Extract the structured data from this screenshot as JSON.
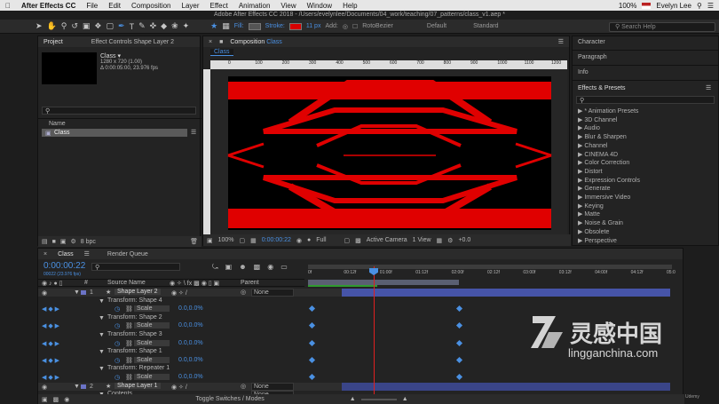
{
  "menubar": {
    "apple": "",
    "app_name": "After Effects CC",
    "items": [
      "File",
      "Edit",
      "Composition",
      "Layer",
      "Effect",
      "Animation",
      "View",
      "Window",
      "Help"
    ],
    "battery": "100%",
    "user": "Evelyn Lee"
  },
  "window_title": "Adobe After Effects CC 2018 - /Users/evelynlee/Documents/04_work/teaching/07_patterns/class_v1.aep *",
  "toolbar": {
    "fill_label": "Fill:",
    "stroke_label": "Stroke:",
    "stroke_px": "11 px",
    "add_label": "Add:",
    "rotobezier": "RotoBezier",
    "workspace_default": "Default",
    "workspace_standard": "Standard",
    "search_placeholder": "Search Help",
    "stroke_color": "#d60000"
  },
  "project_panel": {
    "tab_project": "Project",
    "tab_effect_controls": "Effect Controls Shape Layer 2",
    "comp_name": "Class ▾",
    "comp_size": "1280 x 720 (1.00)",
    "comp_duration": "Δ 0:00:05:00, 23.976 fps",
    "col_name": "Name",
    "item": "Class",
    "bpc": "8 bpc"
  },
  "comp_panel": {
    "tab_label": "Composition",
    "tab_comp": "Class",
    "sub_tab": "Class",
    "ruler_ticks": [
      "0",
      "100",
      "200",
      "300",
      "400",
      "500",
      "600",
      "700",
      "800",
      "900",
      "1000",
      "1100",
      "1200"
    ],
    "zoom": "100%",
    "timecode": "0:00:00:22",
    "resolution": "Full",
    "camera": "Active Camera",
    "view": "1 View",
    "offset": "+0.0"
  },
  "right_panels": {
    "character": "Character",
    "paragraph": "Paragraph",
    "info": "Info",
    "effects_title": "Effects & Presets",
    "effects": [
      "* Animation Presets",
      "3D Channel",
      "Audio",
      "Blur & Sharpen",
      "Channel",
      "CINEMA 4D",
      "Color Correction",
      "Distort",
      "Expression Controls",
      "Generate",
      "Immersive Video",
      "Keying",
      "Matte",
      "Noise & Grain",
      "Obsolete",
      "Perspective"
    ]
  },
  "timeline": {
    "tab_comp": "Class",
    "tab_render": "Render Queue",
    "timecode": "0:00:00:22",
    "frame_info": "00022 (23.976 fps)",
    "col_source": "Source Name",
    "col_parent": "Parent",
    "ruler": [
      "0f",
      "00:12f",
      "01:00f",
      "01:12f",
      "02:00f",
      "02:12f",
      "03:00f",
      "03:12f",
      "04:00f",
      "04:12f",
      "05:0"
    ],
    "rows": [
      {
        "num": "1",
        "name": "Shape Layer 2",
        "kind": "layer",
        "parent": "None"
      },
      {
        "name": "Transform: Shape 4",
        "kind": "group"
      },
      {
        "name": "Scale",
        "value": "0.0,0.0%",
        "kind": "prop"
      },
      {
        "name": "Transform: Shape 2",
        "kind": "group"
      },
      {
        "name": "Scale",
        "value": "0.0,0.0%",
        "kind": "prop"
      },
      {
        "name": "Transform: Shape 3",
        "kind": "group"
      },
      {
        "name": "Scale",
        "value": "0.0,0.0%",
        "kind": "prop"
      },
      {
        "name": "Transform: Shape 1",
        "kind": "group"
      },
      {
        "name": "Scale",
        "value": "0.0,0.0%",
        "kind": "prop"
      },
      {
        "name": "Transform: Repeater 1",
        "kind": "group"
      },
      {
        "name": "Scale",
        "value": "0.0,0.0%",
        "kind": "prop"
      },
      {
        "num": "2",
        "name": "Shape Layer 1",
        "kind": "layer",
        "parent": "None"
      },
      {
        "name": "Contents",
        "kind": "group",
        "parent": "None"
      }
    ],
    "toggle_label": "Toggle Switches / Modes"
  },
  "watermark": {
    "cn": "灵感中国",
    "url": "lingganchina.com",
    "udemy": "Udemy"
  },
  "colors": {
    "accent": "#4a90e2",
    "red": "#e00000",
    "layer_bar": "#4654a8"
  }
}
